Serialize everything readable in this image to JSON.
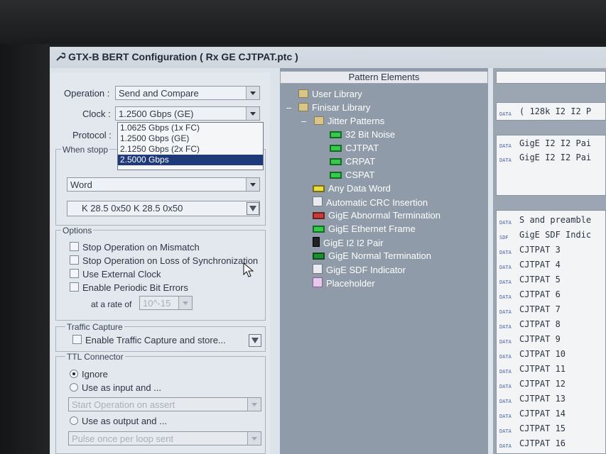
{
  "window": {
    "title": "GTX-B BERT Configuration ( Rx GE CJTPAT.ptc )"
  },
  "left": {
    "operation_label": "Operation :",
    "operation_value": "Send and Compare",
    "clock_label": "Clock :",
    "clock_value": "1.2500 Gbps (GE)",
    "protocol_label": "Protocol :",
    "clock_options": [
      "1.0625 Gbps (1x FC)",
      "1.2500 Gbps (GE)",
      "2.1250 Gbps (2x FC)",
      "2.5000 Gbps"
    ],
    "when_stopped_label": "When stopp",
    "word_value": "Word",
    "pattern_value": "K 28.5 0x50 K 28.5 0x50",
    "options_label": "Options",
    "options": [
      "Stop Operation on Mismatch",
      "Stop Operation on Loss of Synchronization",
      "Use External Clock",
      "Enable Periodic Bit Errors"
    ],
    "rate_label": "at a rate of",
    "rate_value": "10^-15",
    "traffic_label": "Traffic Capture",
    "traffic_option": "Enable Traffic Capture and store...",
    "ttl_label": "TTL Connector",
    "ttl_ignore": "Ignore",
    "ttl_input": "Use as input and ...",
    "ttl_input_value": "Start Operation on assert",
    "ttl_output": "Use as output and ...",
    "ttl_output_value": "Pulse once per loop sent"
  },
  "tree": {
    "header": "Pattern Elements",
    "nodes": [
      "User Library",
      "Finisar Library",
      "Jitter Patterns",
      "32 Bit Noise",
      "CJTPAT",
      "CRPAT",
      "CSPAT",
      "Any Data Word",
      "Automatic CRC Insertion",
      "GigE Abnormal Termination",
      "GigE Ethernet Frame",
      "GigE I2 I2 Pair",
      "GigE Normal Termination",
      "GigE SDF Indicator",
      "Placeholder"
    ]
  },
  "right": {
    "top_line": "( 128k I2 I2 P",
    "box2": [
      "GigE I2 I2 Pai",
      "GigE I2 I2 Pai"
    ],
    "list": [
      "S and preamble",
      "GigE SDF Indic",
      "CJTPAT  3",
      "CJTPAT  4",
      "CJTPAT  5",
      "CJTPAT  6",
      "CJTPAT  7",
      "CJTPAT  8",
      "CJTPAT  9",
      "CJTPAT 10",
      "CJTPAT 11",
      "CJTPAT 12",
      "CJTPAT 13",
      "CJTPAT 14",
      "CJTPAT 15",
      "CJTPAT 16"
    ],
    "tag_data": "DATA",
    "tag_sdf": "SDF"
  },
  "icons": [
    "wrench-icon",
    "folder-icon",
    "dropdown-arrow-icon",
    "filter-icon",
    "pattern-icon"
  ]
}
